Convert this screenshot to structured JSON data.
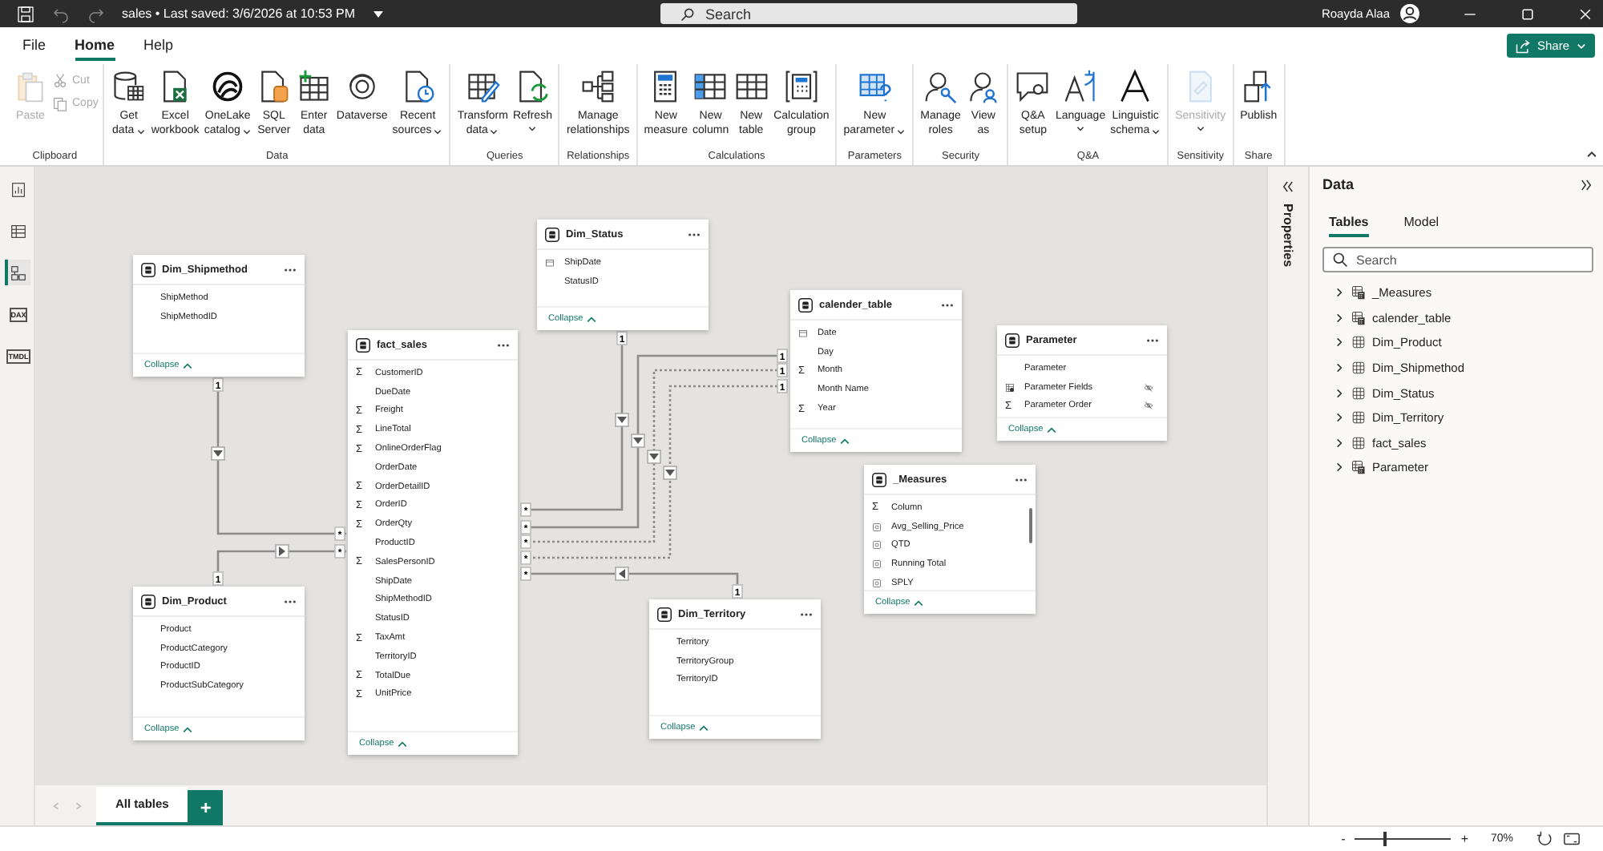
{
  "title_bar": {
    "title": "sales • Last saved: 3/6/2026 at 10:53 PM",
    "search": {
      "placeholder": "Search"
    },
    "user": "Roayda Alaa"
  },
  "menu": [
    {
      "label": "File",
      "selected": false
    },
    {
      "label": "Home",
      "selected": true
    },
    {
      "label": "Help",
      "selected": false
    }
  ],
  "share_button": {
    "label": "Share"
  },
  "ribbon": [
    {
      "label": "Clipboard",
      "buttons": [
        {
          "kind": "large",
          "lines": [
            "Paste"
          ],
          "disabled": true,
          "dropdown": false
        },
        {
          "kind": "small",
          "lines": [
            "Cut"
          ],
          "disabled": true,
          "dropdown": false
        },
        {
          "kind": "small",
          "lines": [
            "Copy"
          ],
          "disabled": true,
          "dropdown": false
        }
      ]
    },
    {
      "label": "Data",
      "buttons": [
        {
          "kind": "large",
          "lines": [
            "Get",
            "data"
          ],
          "disabled": false,
          "dropdown": true
        },
        {
          "kind": "large",
          "lines": [
            "Excel",
            "workbook"
          ],
          "disabled": false,
          "dropdown": false
        },
        {
          "kind": "large",
          "lines": [
            "OneLake",
            "catalog"
          ],
          "disabled": false,
          "dropdown": true
        },
        {
          "kind": "large",
          "lines": [
            "SQL",
            "Server"
          ],
          "disabled": false,
          "dropdown": false
        },
        {
          "kind": "large",
          "lines": [
            "Enter",
            "data"
          ],
          "disabled": false,
          "dropdown": false
        },
        {
          "kind": "large",
          "lines": [
            "Dataverse"
          ],
          "disabled": false,
          "dropdown": false
        },
        {
          "kind": "large",
          "lines": [
            "Recent",
            "sources"
          ],
          "disabled": false,
          "dropdown": true
        }
      ]
    },
    {
      "label": "Queries",
      "buttons": [
        {
          "kind": "large",
          "lines": [
            "Transform",
            "data"
          ],
          "disabled": false,
          "dropdown": true
        },
        {
          "kind": "large",
          "lines": [
            "Refresh"
          ],
          "disabled": false,
          "dropdown": true
        }
      ]
    },
    {
      "label": "Relationships",
      "buttons": [
        {
          "kind": "large",
          "lines": [
            "Manage",
            "relationships"
          ],
          "disabled": false,
          "dropdown": false
        }
      ]
    },
    {
      "label": "Calculations",
      "buttons": [
        {
          "kind": "large",
          "lines": [
            "New",
            "measure"
          ],
          "disabled": false,
          "dropdown": false
        },
        {
          "kind": "large",
          "lines": [
            "New",
            "column"
          ],
          "disabled": false,
          "dropdown": false
        },
        {
          "kind": "large",
          "lines": [
            "New",
            "table"
          ],
          "disabled": false,
          "dropdown": false
        },
        {
          "kind": "large",
          "lines": [
            "Calculation",
            "group"
          ],
          "disabled": false,
          "dropdown": false
        }
      ]
    },
    {
      "label": "Parameters",
      "buttons": [
        {
          "kind": "large",
          "lines": [
            "New",
            "parameter"
          ],
          "disabled": false,
          "dropdown": true
        }
      ]
    },
    {
      "label": "Security",
      "buttons": [
        {
          "kind": "large",
          "lines": [
            "Manage",
            "roles"
          ],
          "disabled": false,
          "dropdown": false
        },
        {
          "kind": "large",
          "lines": [
            "View",
            "as"
          ],
          "disabled": false,
          "dropdown": false
        }
      ]
    },
    {
      "label": "Q&A",
      "buttons": [
        {
          "kind": "large",
          "lines": [
            "Q&A",
            "setup"
          ],
          "disabled": false,
          "dropdown": false
        },
        {
          "kind": "large",
          "lines": [
            "Language"
          ],
          "disabled": false,
          "dropdown": true
        },
        {
          "kind": "large",
          "lines": [
            "Linguistic",
            "schema"
          ],
          "disabled": false,
          "dropdown": true
        }
      ]
    },
    {
      "label": "Sensitivity",
      "buttons": [
        {
          "kind": "large",
          "lines": [
            "Sensitivity"
          ],
          "disabled": true,
          "dropdown": true
        }
      ]
    },
    {
      "label": "Share",
      "buttons": [
        {
          "kind": "large",
          "lines": [
            "Publish"
          ],
          "disabled": false,
          "dropdown": false
        }
      ]
    }
  ],
  "views": [
    {
      "kind": "report",
      "selected": false
    },
    {
      "kind": "table",
      "selected": false
    },
    {
      "kind": "model",
      "selected": true
    },
    {
      "kind": "query",
      "label": "DAX",
      "selected": false
    },
    {
      "kind": "query",
      "label": "TMDL",
      "selected": false
    }
  ],
  "tables": [
    {
      "name": "Dim_Status",
      "fields": [
        {
          "name": "ShipDate",
          "kind": "date"
        },
        {
          "name": "StatusID",
          "kind": "text"
        }
      ],
      "collapse": "Collapse"
    },
    {
      "name": "Dim_Shipmethod",
      "fields": [
        {
          "name": "ShipMethod",
          "kind": "text"
        },
        {
          "name": "ShipMethodID",
          "kind": "text"
        }
      ],
      "collapse": "Collapse"
    },
    {
      "name": "calender_table",
      "fields": [
        {
          "name": "Date",
          "kind": "date"
        },
        {
          "name": "Day",
          "kind": "text"
        },
        {
          "name": "Month",
          "kind": "numeric",
          "symbol": "Σ"
        },
        {
          "name": "Month Name",
          "kind": "text"
        },
        {
          "name": "Year",
          "kind": "numeric",
          "symbol": "Σ"
        }
      ],
      "collapse": "Collapse"
    },
    {
      "name": "fact_sales",
      "fields": [
        {
          "name": "CustomerID",
          "kind": "numeric",
          "symbol": "Σ"
        },
        {
          "name": "DueDate",
          "kind": "text"
        },
        {
          "name": "Freight",
          "kind": "numeric",
          "symbol": "Σ"
        },
        {
          "name": "LineTotal",
          "kind": "numeric",
          "symbol": "Σ"
        },
        {
          "name": "OnlineOrderFlag",
          "kind": "numeric",
          "symbol": "Σ"
        },
        {
          "name": "OrderDate",
          "kind": "text"
        },
        {
          "name": "OrderDetailID",
          "kind": "numeric",
          "symbol": "Σ"
        },
        {
          "name": "OrderID",
          "kind": "numeric",
          "symbol": "Σ"
        },
        {
          "name": "OrderQty",
          "kind": "numeric",
          "symbol": "Σ"
        },
        {
          "name": "ProductID",
          "kind": "text"
        },
        {
          "name": "SalesPersonID",
          "kind": "numeric",
          "symbol": "Σ"
        },
        {
          "name": "ShipDate",
          "kind": "text"
        },
        {
          "name": "ShipMethodID",
          "kind": "text"
        },
        {
          "name": "StatusID",
          "kind": "text"
        },
        {
          "name": "TaxAmt",
          "kind": "numeric",
          "symbol": "Σ"
        },
        {
          "name": "TerritoryID",
          "kind": "text"
        },
        {
          "name": "TotalDue",
          "kind": "numeric",
          "symbol": "Σ"
        },
        {
          "name": "UnitPrice",
          "kind": "numeric",
          "symbol": "Σ"
        }
      ],
      "collapse": "Collapse"
    },
    {
      "name": "Parameter",
      "fields": [
        {
          "name": "Parameter",
          "kind": "text",
          "hidden": false
        },
        {
          "name": "Parameter Fields",
          "kind": "param",
          "hidden": true
        },
        {
          "name": "Parameter Order",
          "kind": "numeric",
          "symbol": "Σ",
          "hidden": true
        }
      ],
      "collapse": "Collapse"
    },
    {
      "name": "_Measures",
      "fields": [
        {
          "name": "Column",
          "kind": "numeric",
          "symbol": "Σ"
        },
        {
          "name": "Avg_Selling_Price",
          "kind": "measure"
        },
        {
          "name": "QTD",
          "kind": "measure"
        },
        {
          "name": "Running Total",
          "kind": "measure"
        },
        {
          "name": "SPLY",
          "kind": "measure"
        }
      ],
      "collapse": "Collapse"
    },
    {
      "name": "Dim_Product",
      "fields": [
        {
          "name": "Product",
          "kind": "text"
        },
        {
          "name": "ProductCategory",
          "kind": "text"
        },
        {
          "name": "ProductID",
          "kind": "text"
        },
        {
          "name": "ProductSubCategory",
          "kind": "text"
        }
      ],
      "collapse": "Collapse"
    },
    {
      "name": "Dim_Territory",
      "fields": [
        {
          "name": "Territory",
          "kind": "text"
        },
        {
          "name": "TerritoryGroup",
          "kind": "text"
        },
        {
          "name": "TerritoryID",
          "kind": "text"
        }
      ],
      "collapse": "Collapse"
    }
  ],
  "relationships": [
    {
      "one": "1",
      "many": "*",
      "active": true
    },
    {
      "one": "1",
      "many": "*",
      "active": true
    },
    {
      "one": "1",
      "many": "*",
      "active": true
    },
    {
      "one": "1",
      "many": "*",
      "active": true
    },
    {
      "one": "1",
      "many": "*",
      "active": false
    },
    {
      "one": "1",
      "many": "*",
      "active": false
    },
    {
      "one": "1",
      "many": "*",
      "active": true
    }
  ],
  "page_tabs": [
    {
      "label": "All tables",
      "selected": true
    }
  ],
  "add_page_button": "+",
  "properties_pane": {
    "title": "Properties"
  },
  "data_pane": {
    "title": "Data",
    "tabs": [
      {
        "label": "Tables",
        "selected": true
      },
      {
        "label": "Model",
        "selected": false
      }
    ],
    "search": {
      "placeholder": "Search"
    },
    "items": [
      {
        "label": "_Measures",
        "kind": "calculated",
        "expanded": false
      },
      {
        "label": "calender_table",
        "kind": "calculated",
        "expanded": false
      },
      {
        "label": "Dim_Product",
        "kind": "table",
        "expanded": false
      },
      {
        "label": "Dim_Shipmethod",
        "kind": "table",
        "expanded": false
      },
      {
        "label": "Dim_Status",
        "kind": "table",
        "expanded": false
      },
      {
        "label": "Dim_Territory",
        "kind": "table",
        "expanded": false
      },
      {
        "label": "fact_sales",
        "kind": "table",
        "expanded": false
      },
      {
        "label": "Parameter",
        "kind": "calculated",
        "expanded": false
      }
    ]
  },
  "zoom": {
    "minus": "-",
    "plus": "+",
    "level": 0.3,
    "reading": "70%"
  }
}
